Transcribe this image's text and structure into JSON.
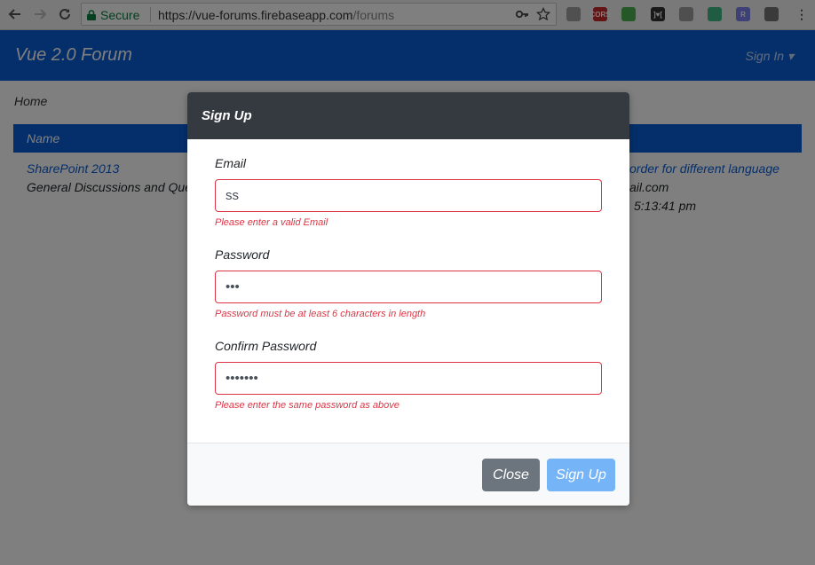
{
  "browser": {
    "secure_label": "Secure",
    "url_host": "https://vue-forums.firebaseapp.com",
    "url_path": "/forums",
    "extensions": [
      {
        "name": "document-icon",
        "color": "#a0a0a0",
        "text": ""
      },
      {
        "name": "cors-icon",
        "color": "#c62828",
        "text": "CORS"
      },
      {
        "name": "toggle-icon",
        "color": "#4caf50",
        "text": ""
      },
      {
        "name": "bracket-icon",
        "color": "#333333",
        "text": "]♥["
      },
      {
        "name": "shield-icon",
        "color": "#9e9e9e",
        "text": ""
      },
      {
        "name": "vue-devtools-icon",
        "color": "#41b883",
        "text": ""
      },
      {
        "name": "r-icon",
        "color": "#7b83eb",
        "text": "R"
      },
      {
        "name": "gray-box-icon",
        "color": "#757575",
        "text": ""
      }
    ]
  },
  "app": {
    "brand": "Vue 2.0 Forum",
    "signin": "Sign In",
    "breadcrumb": "Home",
    "table_header": "Name",
    "row": {
      "title": "SharePoint 2013",
      "desc": "General Discussions and Ques",
      "right_title": "order for different language",
      "right_email": "ail.com",
      "right_time": "5:13:41 pm"
    }
  },
  "modal": {
    "title": "Sign Up",
    "email_label": "Email",
    "email_value": "ss",
    "email_error": "Please enter a valid Email",
    "password_label": "Password",
    "password_value": "•••",
    "password_error": "Password must be at least 6 characters in length",
    "confirm_label": "Confirm Password",
    "confirm_value": "•••••••",
    "confirm_error": "Please enter the same password as above",
    "close_button": "Close",
    "signup_button": "Sign Up"
  }
}
